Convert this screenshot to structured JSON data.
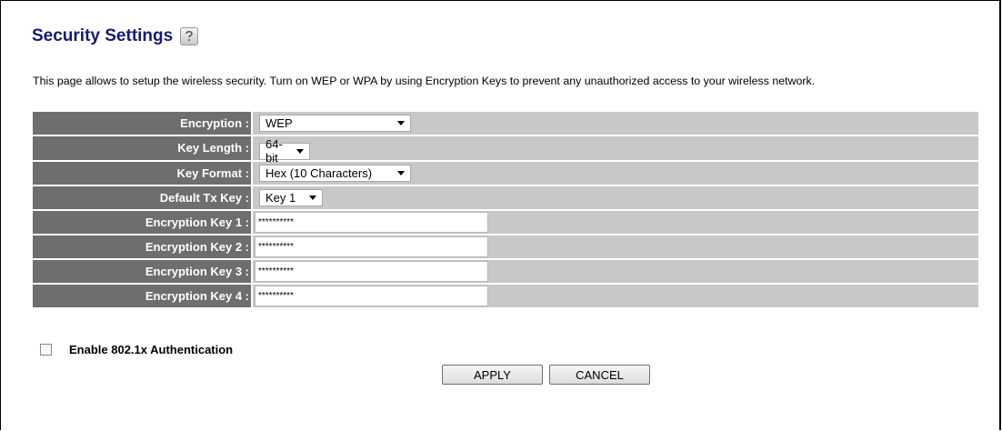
{
  "page": {
    "title": "Security Settings",
    "description": "This page allows to setup the wireless security. Turn on WEP or WPA by using Encryption Keys to prevent any unauthorized access to your wireless network."
  },
  "settings": {
    "encryption": {
      "label": "Encryption :",
      "value": "WEP"
    },
    "key_length": {
      "label": "Key Length :",
      "value": "64-bit"
    },
    "key_format": {
      "label": "Key Format :",
      "value": "Hex (10 Characters)"
    },
    "default_tx_key": {
      "label": "Default Tx Key :",
      "value": "Key 1"
    },
    "keys": [
      {
        "label": "Encryption Key 1 :",
        "value": "**********"
      },
      {
        "label": "Encryption Key 2 :",
        "value": "**********"
      },
      {
        "label": "Encryption Key 3 :",
        "value": "**********"
      },
      {
        "label": "Encryption Key 4 :",
        "value": "**********"
      }
    ]
  },
  "auth": {
    "label": "Enable 802.1x Authentication",
    "checked": false
  },
  "buttons": {
    "apply": "APPLY",
    "cancel": "CANCEL"
  },
  "colors": {
    "label_bg": "#6e6e6e",
    "value_bg": "#c8c8c8",
    "title": "#1a1a6e"
  },
  "icons": {
    "help": "help-icon"
  }
}
